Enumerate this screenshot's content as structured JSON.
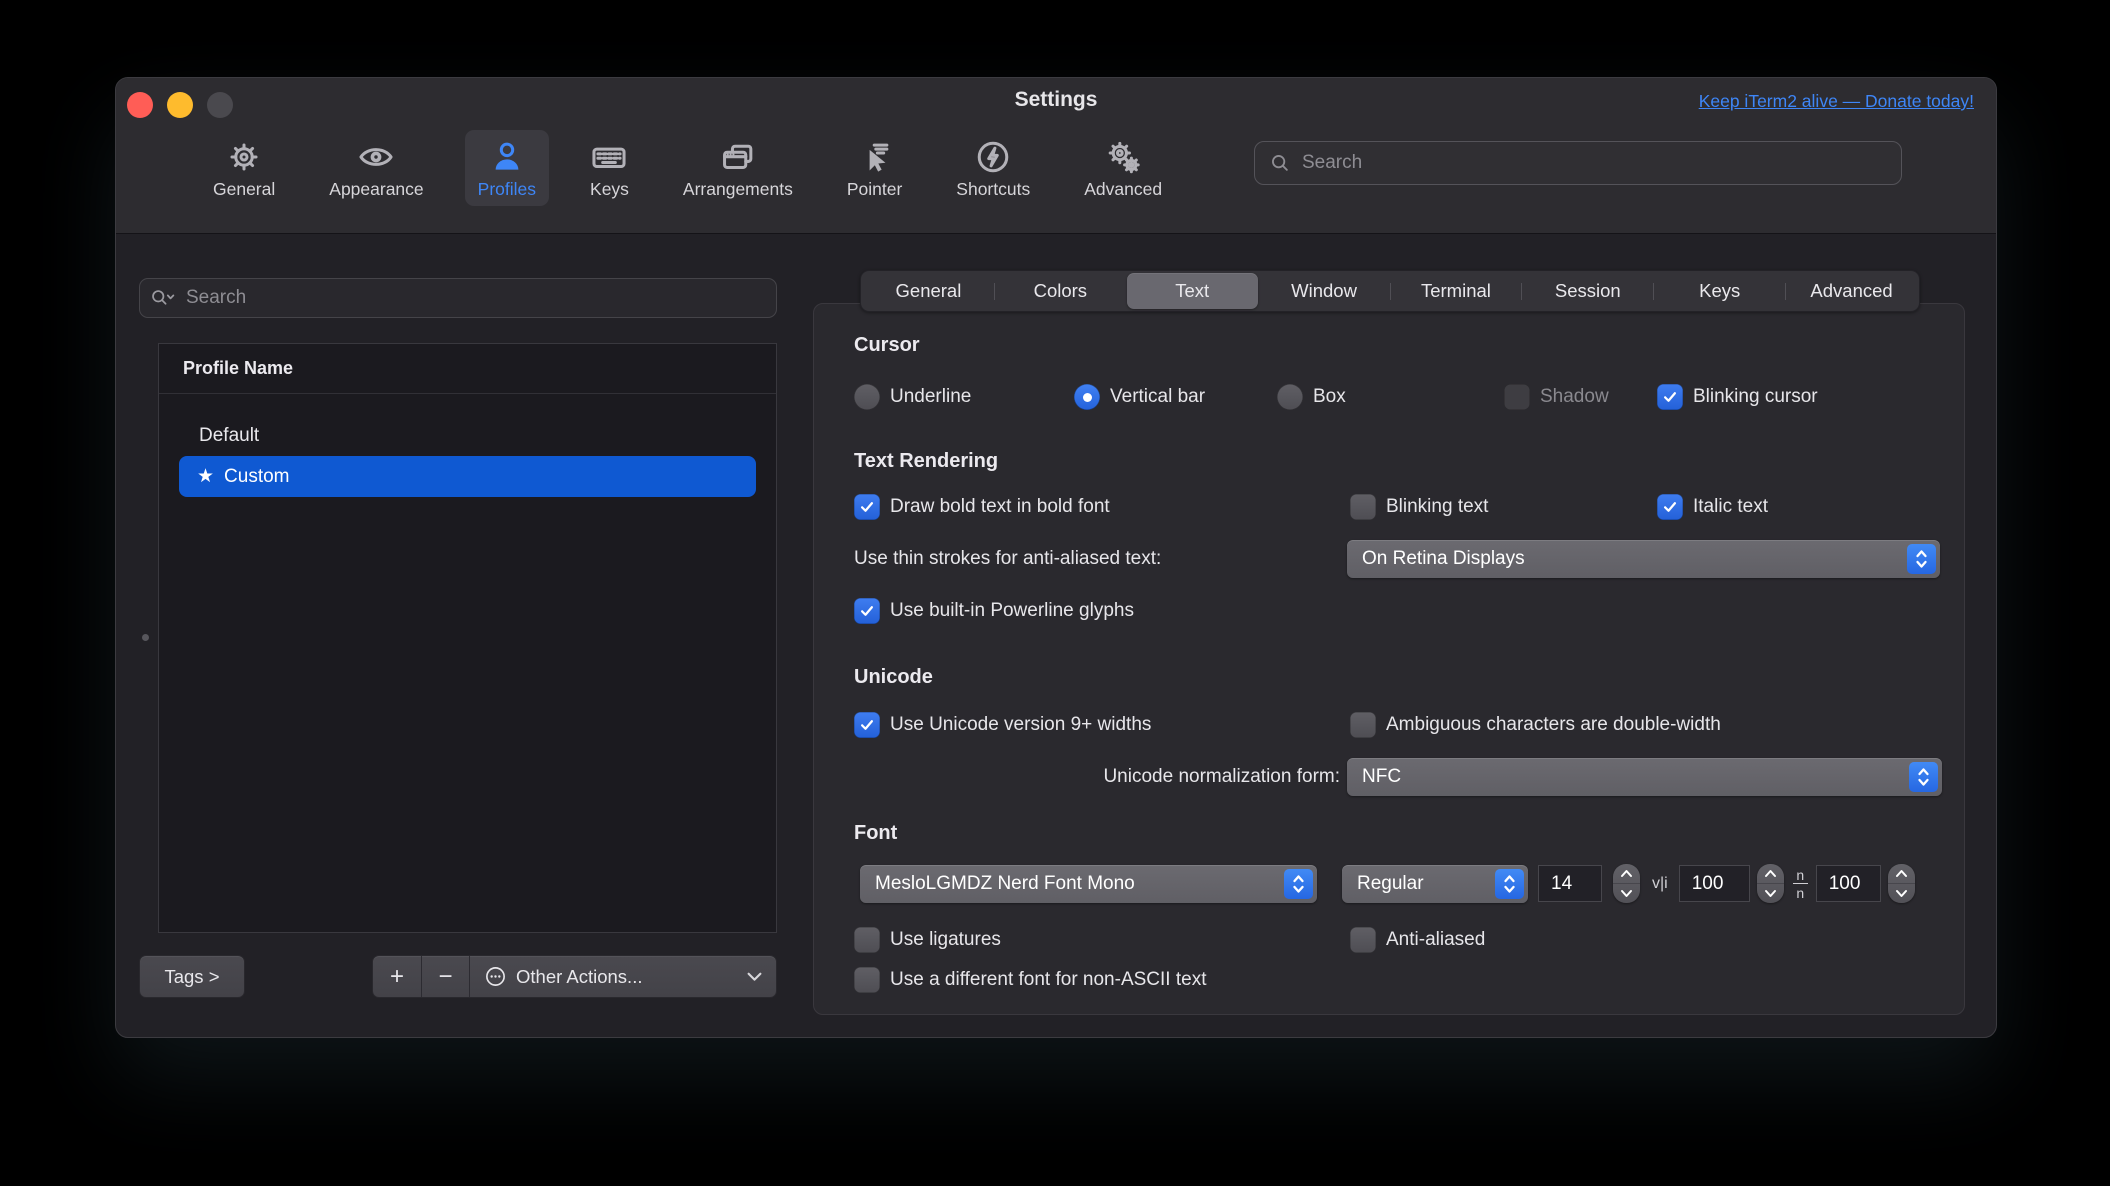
{
  "window": {
    "title": "Settings",
    "donate_link": "Keep iTerm2 alive — Donate today!"
  },
  "toolbar": {
    "search_placeholder": "Search",
    "items": [
      {
        "label": "General",
        "selected": false
      },
      {
        "label": "Appearance",
        "selected": false
      },
      {
        "label": "Profiles",
        "selected": true
      },
      {
        "label": "Keys",
        "selected": false
      },
      {
        "label": "Arrangements",
        "selected": false
      },
      {
        "label": "Pointer",
        "selected": false
      },
      {
        "label": "Shortcuts",
        "selected": false
      },
      {
        "label": "Advanced",
        "selected": false
      }
    ]
  },
  "sidebar": {
    "search_placeholder": "Search",
    "list_header": "Profile Name",
    "profiles": [
      {
        "name": "Default",
        "starred": false,
        "selected": false
      },
      {
        "name": "Custom",
        "starred": true,
        "selected": true
      }
    ],
    "star_glyph": "★",
    "tags_button": "Tags >",
    "add_button": "+",
    "remove_button": "−",
    "other_actions_button": "Other Actions..."
  },
  "tabs": {
    "selected": "Text",
    "items": [
      {
        "label": "General"
      },
      {
        "label": "Colors"
      },
      {
        "label": "Text"
      },
      {
        "label": "Window"
      },
      {
        "label": "Terminal"
      },
      {
        "label": "Session"
      },
      {
        "label": "Keys"
      },
      {
        "label": "Advanced"
      }
    ]
  },
  "panel": {
    "cursor": {
      "title": "Cursor",
      "underline": {
        "label": "Underline",
        "selected": false
      },
      "vertical_bar": {
        "label": "Vertical bar",
        "selected": true
      },
      "box": {
        "label": "Box",
        "selected": false
      },
      "shadow": {
        "label": "Shadow",
        "checked": false,
        "disabled": true
      },
      "blinking_cursor": {
        "label": "Blinking cursor",
        "checked": true
      }
    },
    "text_rendering": {
      "title": "Text Rendering",
      "draw_bold": {
        "label": "Draw bold text in bold font",
        "checked": true
      },
      "blinking_text": {
        "label": "Blinking text",
        "checked": false
      },
      "italic_text": {
        "label": "Italic text",
        "checked": true
      },
      "thin_strokes_label": "Use thin strokes for anti-aliased text:",
      "thin_strokes_value": "On Retina Displays",
      "powerline": {
        "label": "Use built-in Powerline glyphs",
        "checked": true
      }
    },
    "unicode": {
      "title": "Unicode",
      "unicode9": {
        "label": "Use Unicode version 9+ widths",
        "checked": true
      },
      "ambiguous": {
        "label": "Ambiguous characters are double-width",
        "checked": false
      },
      "normalization_label": "Unicode normalization form:",
      "normalization_value": "NFC"
    },
    "font": {
      "title": "Font",
      "family": "MesloLGMDZ Nerd Font Mono",
      "style": "Regular",
      "size": "14",
      "h_spacing_icon": "v|i",
      "v_spacing_icon_top": "n",
      "v_spacing_icon_bottom": "n",
      "horizontal_spacing": "100",
      "vertical_spacing": "100",
      "use_ligatures": {
        "label": "Use ligatures",
        "checked": false
      },
      "anti_aliased": {
        "label": "Anti-aliased",
        "checked": false
      },
      "non_ascii": {
        "label": "Use a different font for non-ASCII text",
        "checked": false
      }
    }
  },
  "colors": {
    "accent_blue": "#2f6ee3",
    "selection_blue": "#0f59d2",
    "link_blue": "#3e86f7",
    "toolbar_selected_blue": "#3e86f7"
  }
}
